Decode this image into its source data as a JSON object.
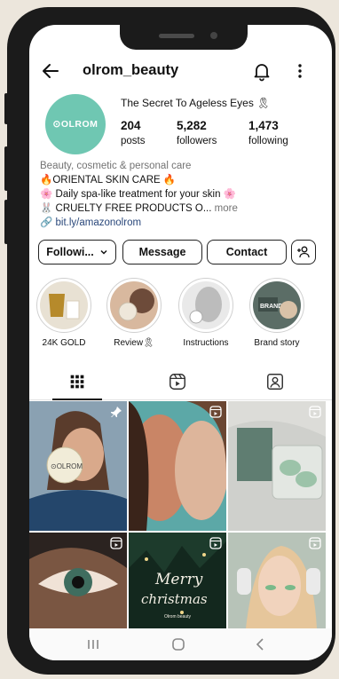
{
  "profile": {
    "username": "olrom_beauty",
    "avatar_text": "⊙OLROM",
    "bio_title": "The Secret To Ageless Eyes 🎗",
    "stats": [
      {
        "value": "204",
        "label": "posts"
      },
      {
        "value": "5,282",
        "label": "followers"
      },
      {
        "value": "1,473",
        "label": "following"
      }
    ],
    "category": "Beauty, cosmetic & personal care",
    "bio_lines": [
      "🔥ORIENTAL SKIN CARE 🔥",
      "🌸 Daily spa-like treatment for your skin 🌸",
      "🐰 CRUELTY FREE PRODUCTS O..."
    ],
    "more_label": "more",
    "link": "bit.ly/amazonolrom"
  },
  "actions": {
    "following": "Followi...",
    "message": "Message",
    "contact": "Contact"
  },
  "highlights": [
    {
      "label": "24K GOLD"
    },
    {
      "label": "Review🎗"
    },
    {
      "label": "Instructions"
    },
    {
      "label": "Brand story"
    }
  ],
  "highlight_brand_text": "BRAND",
  "post_overlay": {
    "line1": "Merry",
    "line2": "christmas",
    "brand": "Olrom beauty"
  },
  "post_product_text": "⊙OLROM",
  "tabs": [
    "grid-icon",
    "reels-icon",
    "tagged-icon"
  ],
  "colors": {
    "avatar": "#6fc7b2",
    "link": "#29477a",
    "background": "#ece6dc"
  }
}
